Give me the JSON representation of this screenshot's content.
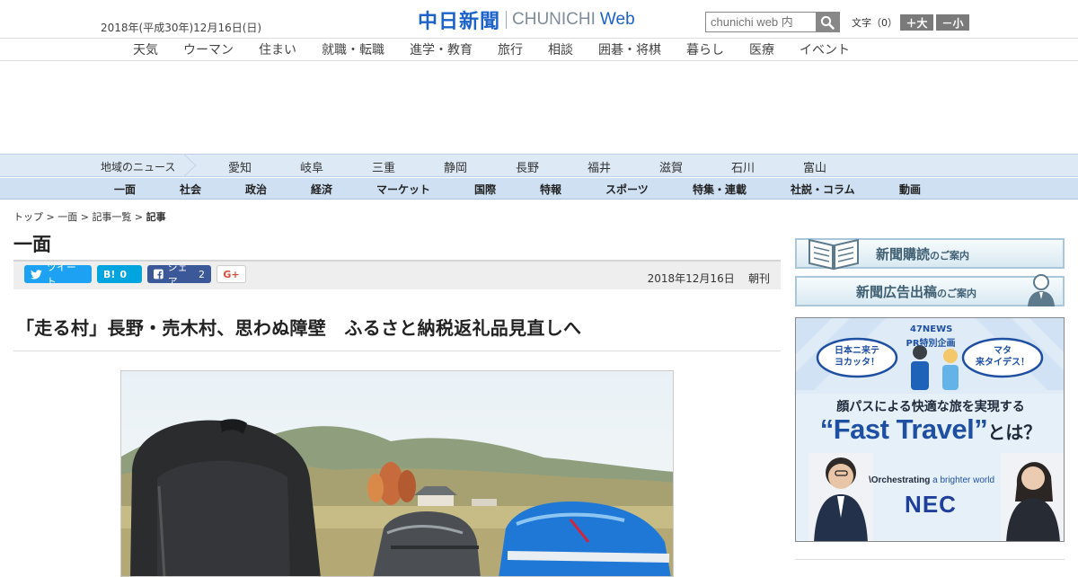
{
  "header": {
    "date": "2018年(平成30年)12月16日(日)",
    "logo_jp": "中日新聞",
    "logo_en": "CHUNICHI",
    "logo_web": "Web",
    "search_placeholder": "chunichi web 内",
    "fontsize_label": "文字（0）",
    "font_larger": "＋大",
    "font_smaller": "－小"
  },
  "category_nav": [
    "天気",
    "ウーマン",
    "住まい",
    "就職・転職",
    "進学・教育",
    "旅行",
    "相談",
    "囲碁・将棋",
    "暮らし",
    "医療",
    "イベント"
  ],
  "region_nav": {
    "label": "地域のニュース",
    "items": [
      "愛知",
      "岐阜",
      "三重",
      "静岡",
      "長野",
      "福井",
      "滋賀",
      "石川",
      "富山"
    ]
  },
  "section_nav": [
    "一面",
    "社会",
    "政治",
    "経済",
    "マーケット",
    "国際",
    "特報",
    "スポーツ",
    "特集・連載",
    "社説・コラム",
    "動画"
  ],
  "breadcrumb": [
    "トップ",
    "一面",
    "記事一覧",
    "記事"
  ],
  "section_title": "一面",
  "share": {
    "tweet": "ツイート",
    "hatena": "B!",
    "hatena_count": "0",
    "facebook": "シェア",
    "facebook_count": "2",
    "gplus": "G+"
  },
  "pub_date": "2018年12月16日",
  "pub_edition": "朝刊",
  "headline": "「走る村」長野・売木村、思わぬ障壁　ふるさと納税返礼品見直しへ",
  "sidebar": {
    "subscribe_main": "新聞購読",
    "subscribe_sub": "のご案内",
    "advertise_main": "新聞広告出稿",
    "advertise_sub": "のご案内"
  },
  "ad": {
    "badge_line1": "47NEWS",
    "badge_line2": "PR特別企画",
    "bubble_left": "日本ニ来テ\nヨカッタ！",
    "bubble_right": "マタ\n来タイデス！",
    "tagline": "顔パスによる快適な旅を実現する",
    "headline": "“Fast Travel”",
    "headline_suffix": "とは？",
    "slogan_prefix": "\\Orchestrating",
    "slogan_suffix": " a brighter world",
    "brand": "NEC",
    "colors": {
      "blue": "#1f4fa3",
      "light": "#dcebf9"
    }
  },
  "colors": {
    "brand_blue": "#1b62c9",
    "nav_bg": "#cfe0f3",
    "region_bg": "#ddeaf6"
  }
}
